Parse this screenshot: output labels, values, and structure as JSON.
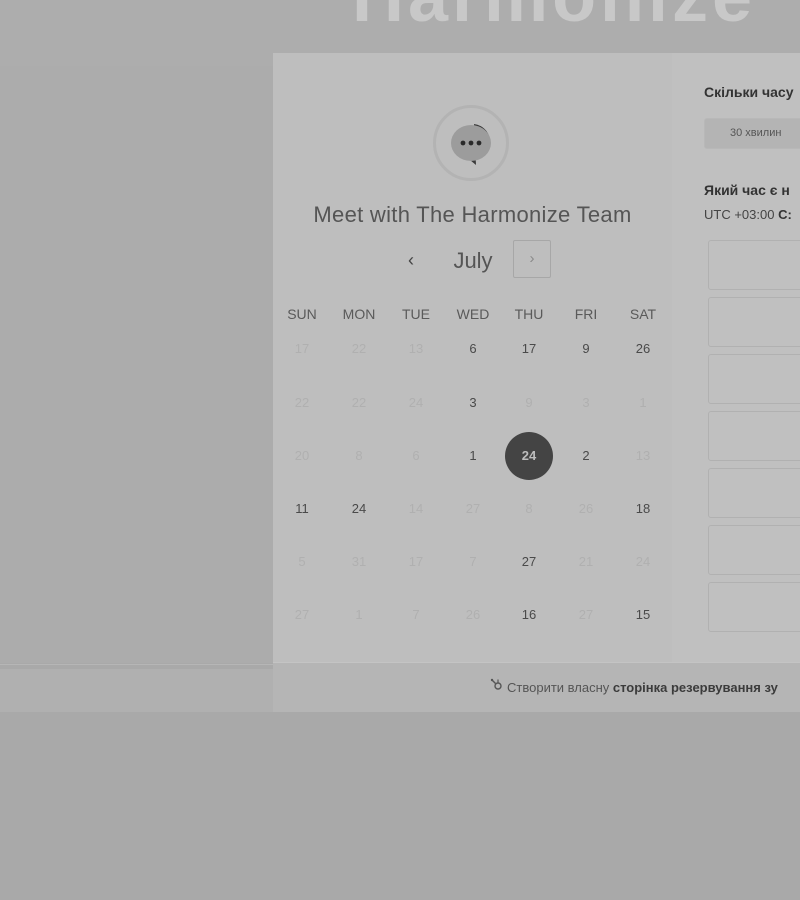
{
  "header": {
    "brand_text": "Harmonize"
  },
  "calendar": {
    "title": "Meet with The Harmonize Team",
    "month": "July",
    "prev_icon": "‹",
    "next_icon": "›",
    "weekdays": [
      "SUN",
      "MON",
      "TUE",
      "WED",
      "THU",
      "FRI",
      "SAT"
    ],
    "weeks": [
      [
        {
          "d": "17",
          "s": "muted"
        },
        {
          "d": "22",
          "s": "muted"
        },
        {
          "d": "13",
          "s": "muted"
        },
        {
          "d": "6",
          "s": "active"
        },
        {
          "d": "17",
          "s": "active"
        },
        {
          "d": "9",
          "s": "active"
        },
        {
          "d": "26",
          "s": "active"
        }
      ],
      [
        {
          "d": "22",
          "s": "muted"
        },
        {
          "d": "22",
          "s": "muted"
        },
        {
          "d": "24",
          "s": "muted"
        },
        {
          "d": "3",
          "s": "active"
        },
        {
          "d": "9",
          "s": "muted"
        },
        {
          "d": "3",
          "s": "muted"
        },
        {
          "d": "1",
          "s": "muted"
        }
      ],
      [
        {
          "d": "20",
          "s": "muted"
        },
        {
          "d": "8",
          "s": "muted"
        },
        {
          "d": "6",
          "s": "muted"
        },
        {
          "d": "1",
          "s": "active"
        },
        {
          "d": "24",
          "s": "selected"
        },
        {
          "d": "2",
          "s": "active"
        },
        {
          "d": "13",
          "s": "muted"
        }
      ],
      [
        {
          "d": "11",
          "s": "active"
        },
        {
          "d": "24",
          "s": "active"
        },
        {
          "d": "14",
          "s": "muted"
        },
        {
          "d": "27",
          "s": "muted"
        },
        {
          "d": "8",
          "s": "muted"
        },
        {
          "d": "26",
          "s": "muted"
        },
        {
          "d": "18",
          "s": "active"
        }
      ],
      [
        {
          "d": "5",
          "s": "muted"
        },
        {
          "d": "31",
          "s": "muted"
        },
        {
          "d": "17",
          "s": "muted"
        },
        {
          "d": "7",
          "s": "muted"
        },
        {
          "d": "27",
          "s": "active"
        },
        {
          "d": "21",
          "s": "muted"
        },
        {
          "d": "24",
          "s": "muted"
        }
      ],
      [
        {
          "d": "27",
          "s": "muted"
        },
        {
          "d": "1",
          "s": "muted"
        },
        {
          "d": "7",
          "s": "muted"
        },
        {
          "d": "26",
          "s": "muted"
        },
        {
          "d": "16",
          "s": "active"
        },
        {
          "d": "27",
          "s": "muted"
        },
        {
          "d": "15",
          "s": "active"
        }
      ]
    ]
  },
  "booking": {
    "duration_question": "Скільки часу",
    "duration_option": "30 хвилин",
    "time_question": "Який час є н",
    "timezone_prefix": "UTC +03:00",
    "timezone_suffix": "С:",
    "slot_count": 7
  },
  "footer": {
    "icon": "sprocket-icon",
    "text_plain": "Створити власну ",
    "text_bold": "сторінка резервування зу"
  },
  "colors": {
    "selected_day_bg": "#444444"
  }
}
